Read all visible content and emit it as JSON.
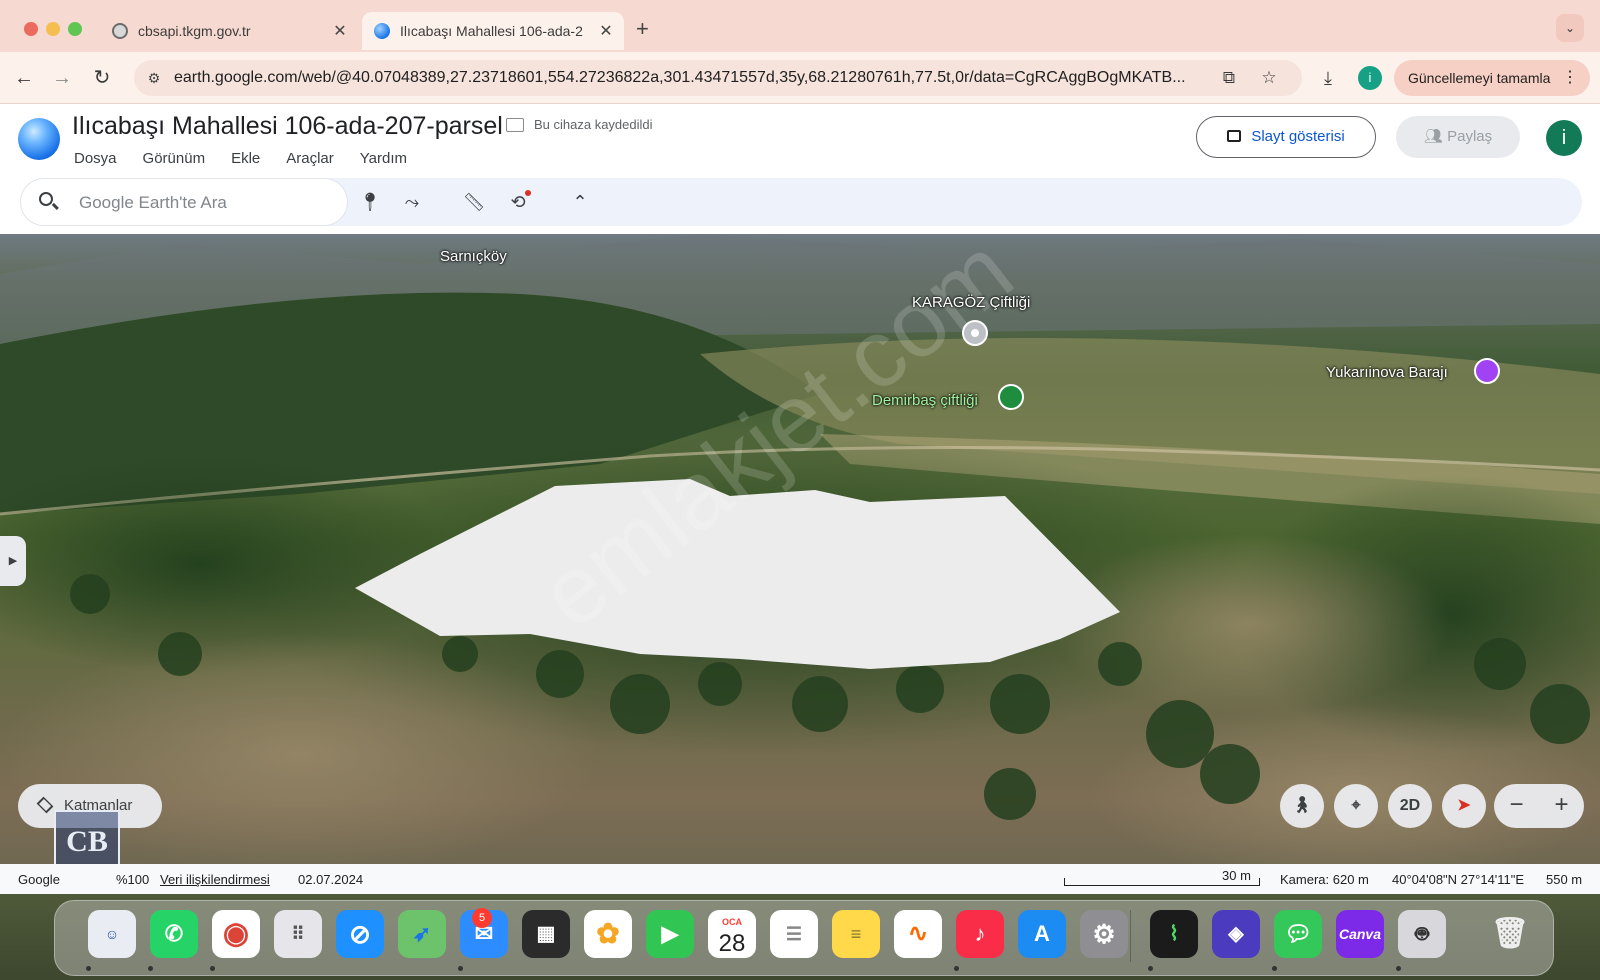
{
  "browser": {
    "tabs": [
      {
        "title": "cbsapi.tkgm.gov.tr",
        "active": false
      },
      {
        "title": "Ilıcabaşı Mahallesi 106-ada-2",
        "active": true
      }
    ],
    "url": "earth.google.com/web/@40.07048389,27.23718601,554.27236822a,301.43471557d,35y,68.21280761h,77.5t,0r/data=CgRCAggBOgMKATB...",
    "profile_initial": "i",
    "update_button": "Güncellemeyi tamamla"
  },
  "earth": {
    "project_title": "Ilıcabaşı Mahallesi 106-ada-207-parsel",
    "saved_status": "Bu cihaza kaydedildi",
    "menu": [
      "Dosya",
      "Görünüm",
      "Ekle",
      "Araçlar",
      "Yardım"
    ],
    "slideshow_button": "Slayt gösterisi",
    "share_button": "Paylaş",
    "account_initial": "i",
    "search_placeholder": "Google Earth'te Ara"
  },
  "map": {
    "labels": {
      "sarnickoy": "Sarnıçköy",
      "karagoz": "KARAGÖZ Çiftliği",
      "demirbas": "Demirbaş çiftliği",
      "yukariinova": "Yukarıinova Barajı"
    },
    "watermark": "emlakjet.com",
    "layers_button": "Katmanlar",
    "mode_button": "2D",
    "zoom_out": "−",
    "zoom_in": "+"
  },
  "status": {
    "google": "Google",
    "zoom": "%100",
    "data_attribution": "Veri ilişkilendirmesi",
    "date": "02.07.2024",
    "scale": "30 m",
    "camera": "Kamera: 620 m",
    "coordinates": "40°04'08\"N 27°14'11\"E",
    "elevation": "550 m"
  },
  "overlay_logo": "CB",
  "dock": {
    "calendar_month": "OCA",
    "calendar_day": "28",
    "mail_badge": "5",
    "canva_label": "Canva"
  },
  "colors": {
    "tab_strip": "#f6d9d1",
    "toolbar": "#fdf1ec",
    "accent_blue": "#0b57d0",
    "parcel_fill": "#ececec"
  }
}
